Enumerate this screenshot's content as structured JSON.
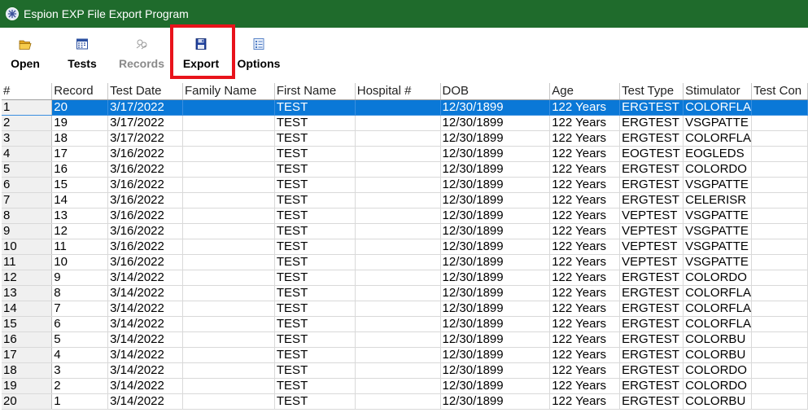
{
  "window": {
    "title": "Espion EXP File Export Program"
  },
  "toolbar": {
    "open_label": "Open",
    "tests_label": "Tests",
    "records_label": "Records",
    "export_label": "Export",
    "options_label": "Options"
  },
  "table": {
    "headers": [
      "#",
      "Record",
      "Test Date",
      "Family Name",
      "First Name",
      "Hospital #",
      "DOB",
      "Age",
      "Test Type",
      "Stimulator",
      "Test Con"
    ],
    "rows": [
      [
        "1",
        "20",
        "3/17/2022",
        "",
        "TEST",
        "",
        "12/30/1899",
        "122 Years",
        "ERGTEST",
        "COLORFLA"
      ],
      [
        "2",
        "19",
        "3/17/2022",
        "",
        "TEST",
        "",
        "12/30/1899",
        "122 Years",
        "ERGTEST",
        "VSGPATTE"
      ],
      [
        "3",
        "18",
        "3/17/2022",
        "",
        "TEST",
        "",
        "12/30/1899",
        "122 Years",
        "ERGTEST",
        "COLORFLA"
      ],
      [
        "4",
        "17",
        "3/16/2022",
        "",
        "TEST",
        "",
        "12/30/1899",
        "122 Years",
        "EOGTEST",
        "EOGLEDS"
      ],
      [
        "5",
        "16",
        "3/16/2022",
        "",
        "TEST",
        "",
        "12/30/1899",
        "122 Years",
        "ERGTEST",
        "COLORDO"
      ],
      [
        "6",
        "15",
        "3/16/2022",
        "",
        "TEST",
        "",
        "12/30/1899",
        "122 Years",
        "ERGTEST",
        "VSGPATTE"
      ],
      [
        "7",
        "14",
        "3/16/2022",
        "",
        "TEST",
        "",
        "12/30/1899",
        "122 Years",
        "ERGTEST",
        "CELERISR"
      ],
      [
        "8",
        "13",
        "3/16/2022",
        "",
        "TEST",
        "",
        "12/30/1899",
        "122 Years",
        "VEPTEST",
        "VSGPATTE"
      ],
      [
        "9",
        "12",
        "3/16/2022",
        "",
        "TEST",
        "",
        "12/30/1899",
        "122 Years",
        "VEPTEST",
        "VSGPATTE"
      ],
      [
        "10",
        "11",
        "3/16/2022",
        "",
        "TEST",
        "",
        "12/30/1899",
        "122 Years",
        "VEPTEST",
        "VSGPATTE"
      ],
      [
        "11",
        "10",
        "3/16/2022",
        "",
        "TEST",
        "",
        "12/30/1899",
        "122 Years",
        "VEPTEST",
        "VSGPATTE"
      ],
      [
        "12",
        "9",
        "3/14/2022",
        "",
        "TEST",
        "",
        "12/30/1899",
        "122 Years",
        "ERGTEST",
        "COLORDO"
      ],
      [
        "13",
        "8",
        "3/14/2022",
        "",
        "TEST",
        "",
        "12/30/1899",
        "122 Years",
        "ERGTEST",
        "COLORFLA"
      ],
      [
        "14",
        "7",
        "3/14/2022",
        "",
        "TEST",
        "",
        "12/30/1899",
        "122 Years",
        "ERGTEST",
        "COLORFLA"
      ],
      [
        "15",
        "6",
        "3/14/2022",
        "",
        "TEST",
        "",
        "12/30/1899",
        "122 Years",
        "ERGTEST",
        "COLORFLA"
      ],
      [
        "16",
        "5",
        "3/14/2022",
        "",
        "TEST",
        "",
        "12/30/1899",
        "122 Years",
        "ERGTEST",
        "COLORBU"
      ],
      [
        "17",
        "4",
        "3/14/2022",
        "",
        "TEST",
        "",
        "12/30/1899",
        "122 Years",
        "ERGTEST",
        "COLORBU"
      ],
      [
        "18",
        "3",
        "3/14/2022",
        "",
        "TEST",
        "",
        "12/30/1899",
        "122 Years",
        "ERGTEST",
        "COLORDO"
      ],
      [
        "19",
        "2",
        "3/14/2022",
        "",
        "TEST",
        "",
        "12/30/1899",
        "122 Years",
        "ERGTEST",
        "COLORDO"
      ],
      [
        "20",
        "1",
        "3/14/2022",
        "",
        "TEST",
        "",
        "12/30/1899",
        "122 Years",
        "ERGTEST",
        "COLORBU"
      ]
    ],
    "selected_row": 0
  },
  "colors": {
    "titlebar": "#1f6b2c",
    "selection": "#0a78d7",
    "highlight": "#e8131b"
  },
  "icons": {
    "open": "folder-open-icon",
    "tests": "calendar-icon",
    "records": "records-icon",
    "export": "floppy-disk-icon",
    "options": "options-list-icon"
  }
}
